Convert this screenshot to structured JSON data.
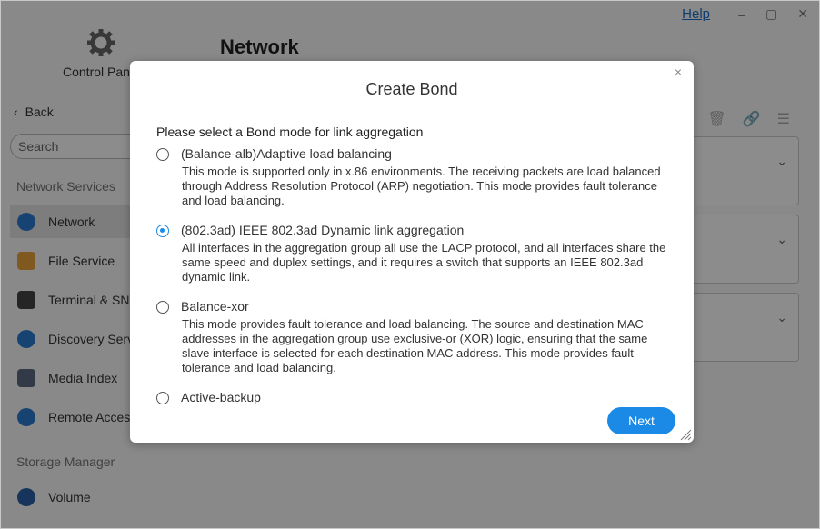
{
  "window": {
    "help_label": "Help",
    "controls": [
      "–",
      "▢",
      "✕"
    ]
  },
  "sidebar": {
    "app_label": "Control Panel",
    "back_label": "Back",
    "search_placeholder": "Search",
    "section_network": "Network Services",
    "section_storage": "Storage Manager",
    "items": [
      {
        "label": "Network",
        "icon": "globe-icon",
        "color": "#2a7bd1"
      },
      {
        "label": "File Service",
        "icon": "folder-icon",
        "color": "#e8a23a"
      },
      {
        "label": "Terminal & SNMP",
        "icon": "terminal-icon",
        "color": "#444444"
      },
      {
        "label": "Discovery Service",
        "icon": "discovery-icon",
        "color": "#2a7bd1"
      },
      {
        "label": "Media Index",
        "icon": "media-icon",
        "color": "#5a6b80"
      },
      {
        "label": "Remote Access",
        "icon": "cloud-icon",
        "color": "#2a7bd1"
      },
      {
        "label": "Volume",
        "icon": "volume-icon",
        "color": "#2a5fa8"
      }
    ]
  },
  "main": {
    "title": "Network"
  },
  "dialog": {
    "title": "Create Bond",
    "prompt": "Please select a Bond mode for link aggregation",
    "options": [
      {
        "label": "(Balance-alb)Adaptive load balancing",
        "description": "This mode is supported only in x.86 environments. The receiving packets are load balanced through Address Resolution Protocol (ARP) negotiation. This mode provides fault tolerance and load balancing.",
        "selected": false
      },
      {
        "label": "(802.3ad) IEEE 802.3ad Dynamic link aggregation",
        "description": "All interfaces in the aggregation group all use the LACP protocol, and all interfaces share the same speed and duplex settings, and it requires a switch that supports an IEEE 802.3ad dynamic link.",
        "selected": true
      },
      {
        "label": "Balance-xor",
        "description": "This mode provides fault tolerance and load balancing. The source and destination MAC addresses in the aggregation group use exclusive-or (XOR) logic, ensuring that the same slave interface is selected for each destination MAC address. This mode provides fault tolerance and load balancing.",
        "selected": false
      },
      {
        "label": "Active-backup",
        "description": "",
        "selected": false
      }
    ],
    "next_label": "Next",
    "close_glyph": "×"
  },
  "colors": {
    "accent": "#1a8ae6",
    "overlay": "rgba(0,0,0,0.45)"
  }
}
